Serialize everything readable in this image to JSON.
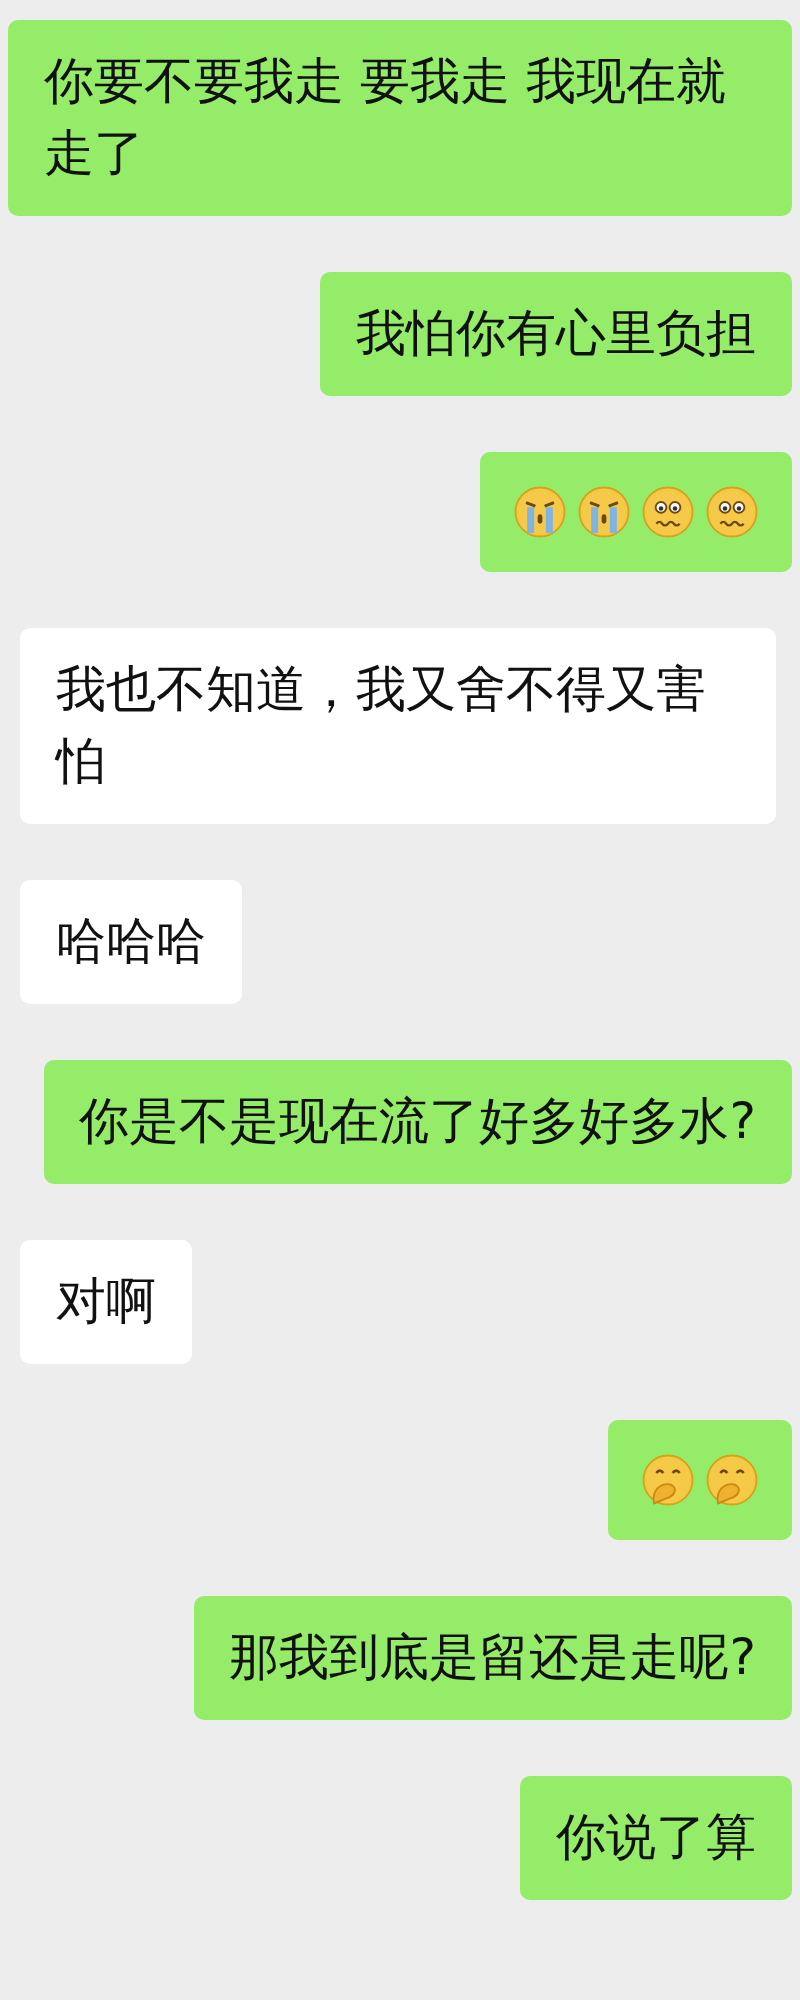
{
  "messages": [
    {
      "sent": true,
      "kind": "text",
      "text": "你要不要我走 要我走 我现在就走了"
    },
    {
      "sent": true,
      "kind": "text",
      "text": "我怕你有心里负担"
    },
    {
      "sent": true,
      "kind": "emoji",
      "emojis": [
        {
          "kind": "crying"
        },
        {
          "kind": "crying"
        },
        {
          "kind": "worried"
        },
        {
          "kind": "worried"
        }
      ]
    },
    {
      "sent": false,
      "kind": "text",
      "text": "我也不知道，我又舍不得又害怕"
    },
    {
      "sent": false,
      "kind": "text",
      "text": "哈哈哈"
    },
    {
      "sent": true,
      "kind": "text",
      "text": "你是不是现在流了好多好多水?"
    },
    {
      "sent": false,
      "kind": "text",
      "text": "对啊"
    },
    {
      "sent": true,
      "kind": "emoji",
      "emojis": [
        {
          "kind": "giggle"
        },
        {
          "kind": "giggle"
        }
      ]
    },
    {
      "sent": true,
      "kind": "text",
      "text": "那我到底是留还是走呢?"
    },
    {
      "sent": true,
      "kind": "text",
      "text": "你说了算"
    }
  ]
}
